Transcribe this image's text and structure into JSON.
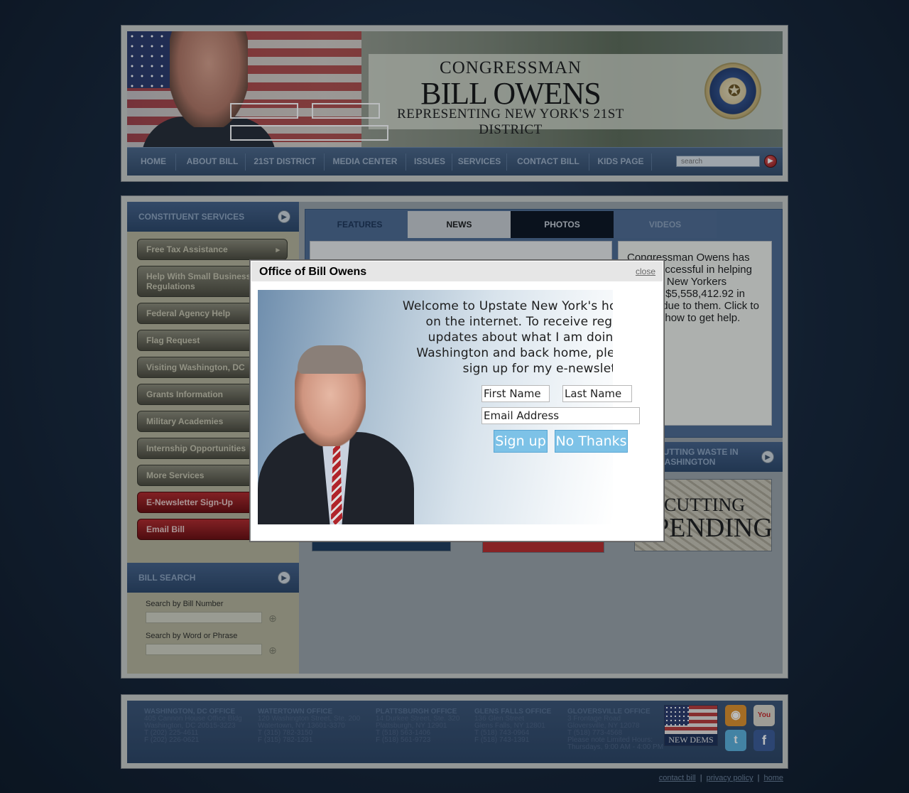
{
  "header": {
    "title_small": "CONGRESSMAN",
    "title_name": "BILL OWENS",
    "title_sub": "REPRESENTING NEW YORK'S 21ST DISTRICT",
    "seal_icon": "house-seal-icon"
  },
  "nav": {
    "items": [
      "HOME",
      "ABOUT BILL",
      "21ST DISTRICT",
      "MEDIA CENTER",
      "ISSUES",
      "SERVICES",
      "CONTACT BILL",
      "KIDS PAGE"
    ],
    "search_placeholder": "search"
  },
  "sidebar": {
    "constituent_header": "CONSTITUENT SERVICES",
    "services": [
      "Free Tax Assistance",
      "Help With Small Business Regulations",
      "Federal Agency Help",
      "Flag Request",
      "Visiting Washington, DC",
      "Grants Information",
      "Military Academies",
      "Internship Opportunities",
      "More Services",
      "E-Newsletter Sign-Up",
      "Email Bill"
    ],
    "bill_search_header": "BILL SEARCH",
    "search_by_number": "Search by Bill Number",
    "search_by_word": "Search by Word or Phrase"
  },
  "content": {
    "tabs": [
      "FEATURES",
      "NEWS",
      "PHOTOS",
      "VIDEOS"
    ],
    "feature_text": "Congressman Owens has been successful in helping Upstate New Yorkers recover $5,558,412.92 in money due to them. Click to find out how to get help.",
    "waste_header": "CUTTING WASTE IN WASHINGTON",
    "cutting_line1": "CUTTING",
    "cutting_line2": "SPENDING"
  },
  "footer": {
    "offices": [
      {
        "name": "WASHINGTON, DC OFFICE",
        "lines": [
          "405 Cannon House Office Bldg",
          "Washington, DC 20515-3223",
          "T (202) 225-4611",
          "F (202) 226-0621"
        ]
      },
      {
        "name": "WATERTOWN OFFICE",
        "lines": [
          "120 Washington Street, Ste. 200",
          "Watertown, NY 13601-3370",
          "T (315) 782-3150",
          "F (315) 782-1291"
        ]
      },
      {
        "name": "PLATTSBURGH OFFICE",
        "lines": [
          "14 Durkee Street, Ste. 320",
          "Plattsburgh, NY 12901",
          "T (518) 563-1406",
          "F (518) 561-9723"
        ]
      },
      {
        "name": "GLENS FALLS OFFICE",
        "lines": [
          "136 Glen Street",
          "Glens Falls, NY 12801",
          "T (518) 743-0964",
          "F (518) 743-1391"
        ]
      },
      {
        "name": "GLOVERSVILLE OFFICE",
        "lines": [
          "3 Frontage Road",
          "Gloversville, NY 12078",
          "T (518) 773-4568",
          "Please note Limited Hours:",
          "Thursdays, 9:00 AM - 4:00 PM"
        ]
      }
    ],
    "new_dems": "NEW DEMS",
    "social": [
      "rss-icon",
      "youtube-icon",
      "twitter-icon",
      "facebook-icon"
    ]
  },
  "bottom_links": [
    "contact bill",
    "privacy policy",
    "home"
  ],
  "modal": {
    "title": "Office of Bill Owens",
    "close": "close",
    "message": "Welcome to Upstate New York's home on the internet. To receive regular updates about what I am doing in Washington and back home, please sign up for my e-newsletter.",
    "first_name_placeholder": "First Name",
    "last_name_placeholder": "Last Name",
    "email_placeholder": "Email Address",
    "signup": "Sign up",
    "no_thanks": "No Thanks"
  },
  "colors": {
    "nav_bg": "#3f5a7d",
    "red_button": "#8e1517",
    "modal_button": "#7dc2e7"
  }
}
